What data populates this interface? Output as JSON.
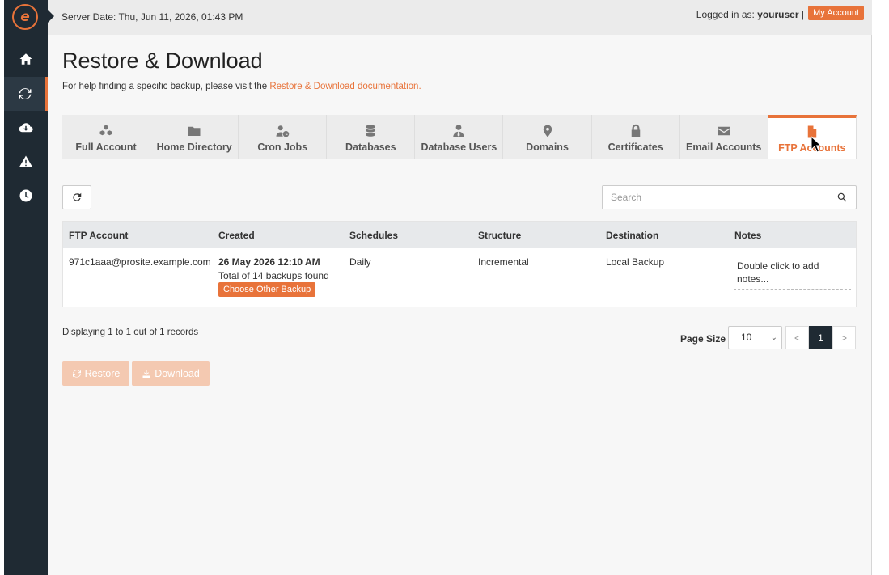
{
  "header": {
    "server_date": "Server Date: Thu, Jun 11, 2026, 01:43 PM",
    "logged_in_prefix": "Logged in as:",
    "username": "youruser",
    "separator": "|",
    "my_account_label": "My Account"
  },
  "sidebar": {
    "items": [
      {
        "icon": "home-icon"
      },
      {
        "icon": "refresh-icon",
        "active": true
      },
      {
        "icon": "cloud-download-icon"
      },
      {
        "icon": "warning-icon"
      },
      {
        "icon": "clock-icon"
      }
    ]
  },
  "page": {
    "title": "Restore & Download",
    "help_text": "For help finding a specific backup, please visit the",
    "help_link": "Restore & Download documentation."
  },
  "tabs": [
    {
      "label": "Full Account",
      "icon": "cubes-icon"
    },
    {
      "label": "Home Directory",
      "icon": "folder-icon"
    },
    {
      "label": "Cron Jobs",
      "icon": "user-clock-icon"
    },
    {
      "label": "Databases",
      "icon": "database-icon"
    },
    {
      "label": "Database Users",
      "icon": "user-tie-icon"
    },
    {
      "label": "Domains",
      "icon": "map-marker-icon"
    },
    {
      "label": "Certificates",
      "icon": "lock-icon"
    },
    {
      "label": "Email Accounts",
      "icon": "envelope-icon"
    },
    {
      "label": "FTP Accounts",
      "icon": "file-icon",
      "active": true
    }
  ],
  "search": {
    "placeholder": "Search"
  },
  "table": {
    "columns": [
      "FTP Account",
      "Created",
      "Schedules",
      "Structure",
      "Destination",
      "Notes"
    ],
    "rows": [
      {
        "account": "971c1aaa@prosite.example.com",
        "created_date": "26 May 2026 12:10 AM",
        "backups_found": "Total of 14 backups found",
        "choose_label": "Choose Other Backup",
        "schedule": "Daily",
        "structure": "Incremental",
        "destination": "Local Backup",
        "notes": "Double click to add notes..."
      }
    ]
  },
  "pagination": {
    "display_text": "Displaying 1 to 1 out of 1 records",
    "page_size_label": "Page Size",
    "page_size_value": "10",
    "prev": "<",
    "current": "1",
    "next": ">"
  },
  "actions": {
    "restore_label": "Restore",
    "download_label": "Download"
  },
  "colors": {
    "accent": "#e8733a",
    "sidebar": "#1f2a33"
  }
}
